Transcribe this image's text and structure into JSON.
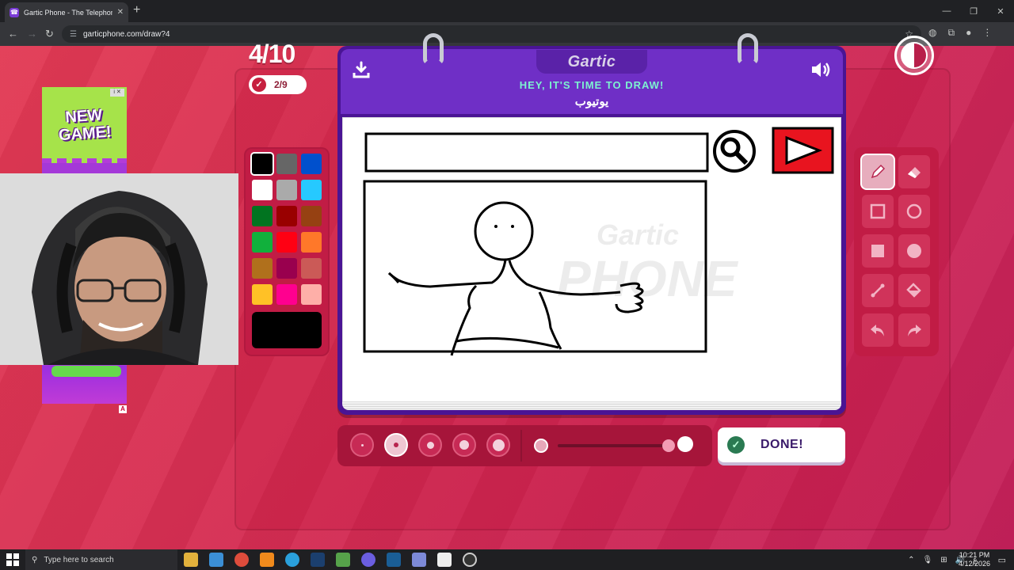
{
  "browser": {
    "tab_title": "Gartic Phone - The Telephone G",
    "tab_close": "✕",
    "new_tab": "+",
    "url": "garticphone.com/draw?4"
  },
  "game": {
    "round": "4/10",
    "players_done": "2/9",
    "logo": "Gartic",
    "title": "HEY, IT'S TIME TO DRAW!",
    "prompt": "يوتيوب",
    "done_label": "DONE!",
    "watermark": "Gartic PHONE"
  },
  "palette": {
    "colors": [
      "#000000",
      "#666666",
      "#0050cd",
      "#ffffff",
      "#aaaaaa",
      "#26c9ff",
      "#017420",
      "#990000",
      "#964112",
      "#11b03c",
      "#ff0013",
      "#ff7829",
      "#b0701c",
      "#99004e",
      "#cb5a57",
      "#ffc126",
      "#ff008f",
      "#feafa8"
    ],
    "selected": "#000000"
  },
  "tools": [
    "pencil",
    "eraser",
    "rectangle-outline",
    "ellipse-outline",
    "rectangle-filled",
    "ellipse-filled",
    "line",
    "fill",
    "undo",
    "redo"
  ],
  "brush": {
    "sizes": 5,
    "selected_index": 1,
    "opacity_percent": 100
  },
  "ad": {
    "text": "NEW GAME!",
    "mark": "A"
  },
  "taskbar": {
    "search_placeholder": "Type here to search",
    "time": "10:21 PM",
    "date": "4/12/2026"
  }
}
